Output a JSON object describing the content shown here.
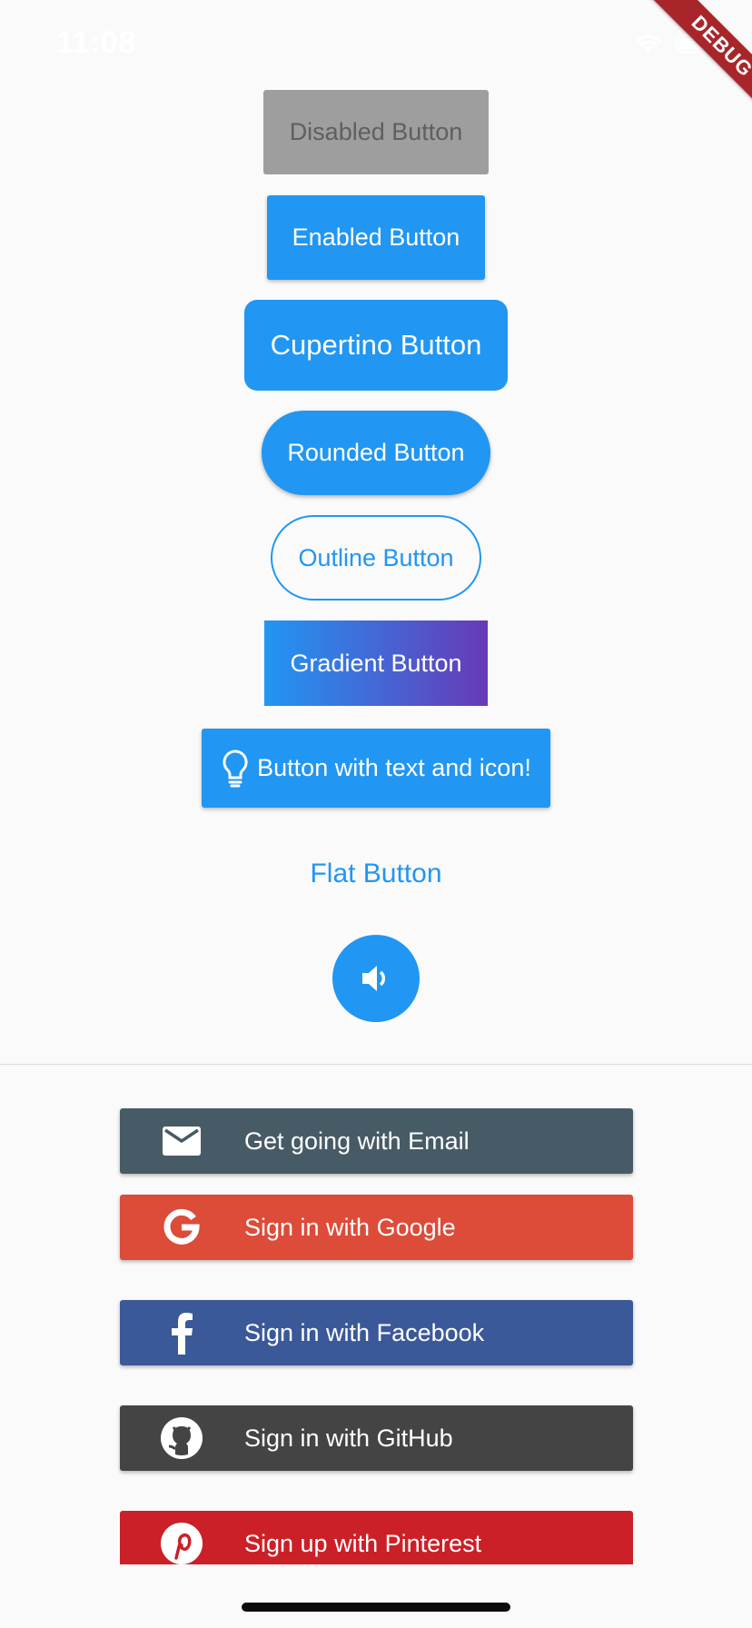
{
  "status_bar": {
    "time": "11:08"
  },
  "debug_banner": {
    "label": "DEBUG"
  },
  "buttons": {
    "disabled": "Disabled Button",
    "enabled": "Enabled Button",
    "cupertino": "Cupertino Button",
    "rounded": "Rounded Button",
    "outline": "Outline Button",
    "gradient": "Gradient Button",
    "text_and_icon": "Button with text and icon!",
    "flat": "Flat Button"
  },
  "fab": {
    "icon": "volume-up-icon"
  },
  "social_buttons": {
    "email": "Get going with Email",
    "google": "Sign in with Google",
    "facebook": "Sign in with Facebook",
    "github": "Sign in with GitHub",
    "pinterest": "Sign up with Pinterest"
  },
  "colors": {
    "primary": "#2196f3",
    "disabled": "#9e9e9e",
    "gradient_end": "#673ab7",
    "email": "#475b66",
    "google": "#dd4b39",
    "facebook": "#3b5998",
    "github": "#444444",
    "pinterest": "#cb2027",
    "debug": "#a8262a"
  }
}
